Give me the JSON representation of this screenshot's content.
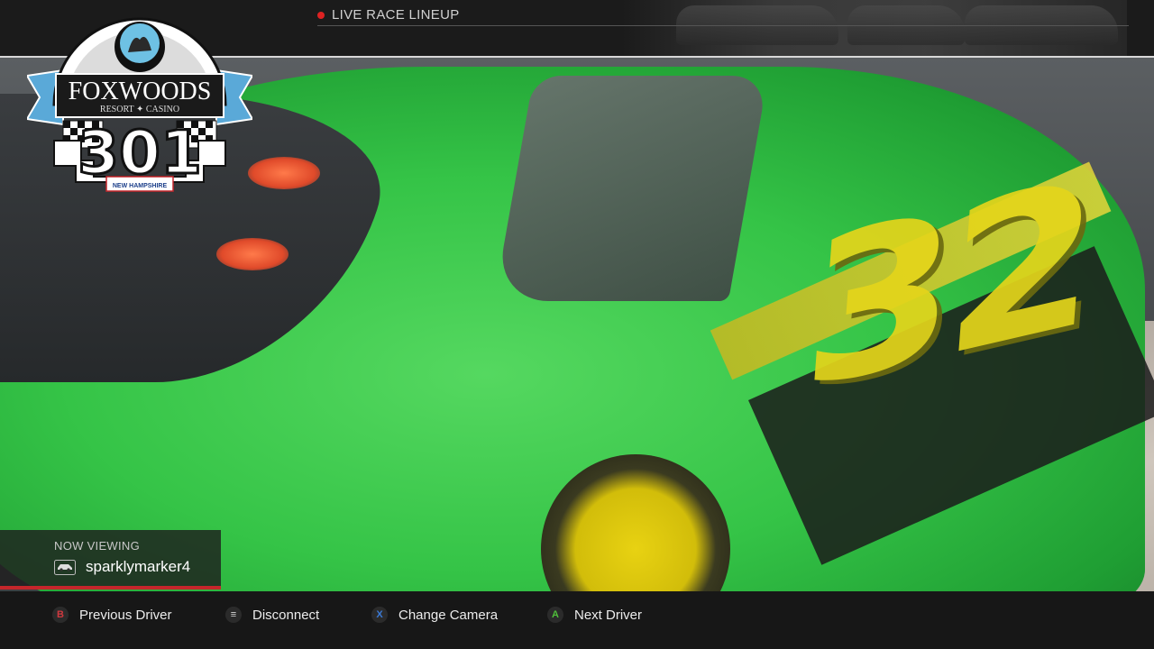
{
  "topbar": {
    "live_label": "LIVE RACE LINEUP"
  },
  "logo": {
    "brand": "FOXWOODS",
    "subtitle": "RESORT ✦ CASINO",
    "race_number": "301",
    "track": "NEW HAMPSHIRE"
  },
  "scene": {
    "car_number": "32"
  },
  "now_viewing": {
    "label": "NOW VIEWING",
    "driver": "sparklymarker4"
  },
  "hints": [
    {
      "button": "B",
      "label": "Previous Driver",
      "color": "#d0393f"
    },
    {
      "button": "≡",
      "label": "Disconnect",
      "color": "#d8d8d8"
    },
    {
      "button": "X",
      "label": "Change Camera",
      "color": "#3b7bd8"
    },
    {
      "button": "A",
      "label": "Next Driver",
      "color": "#4fbf3a"
    }
  ],
  "colors": {
    "accent_red": "#c5262b",
    "car_green": "#35c447",
    "car_yellow": "#e4d51b"
  }
}
